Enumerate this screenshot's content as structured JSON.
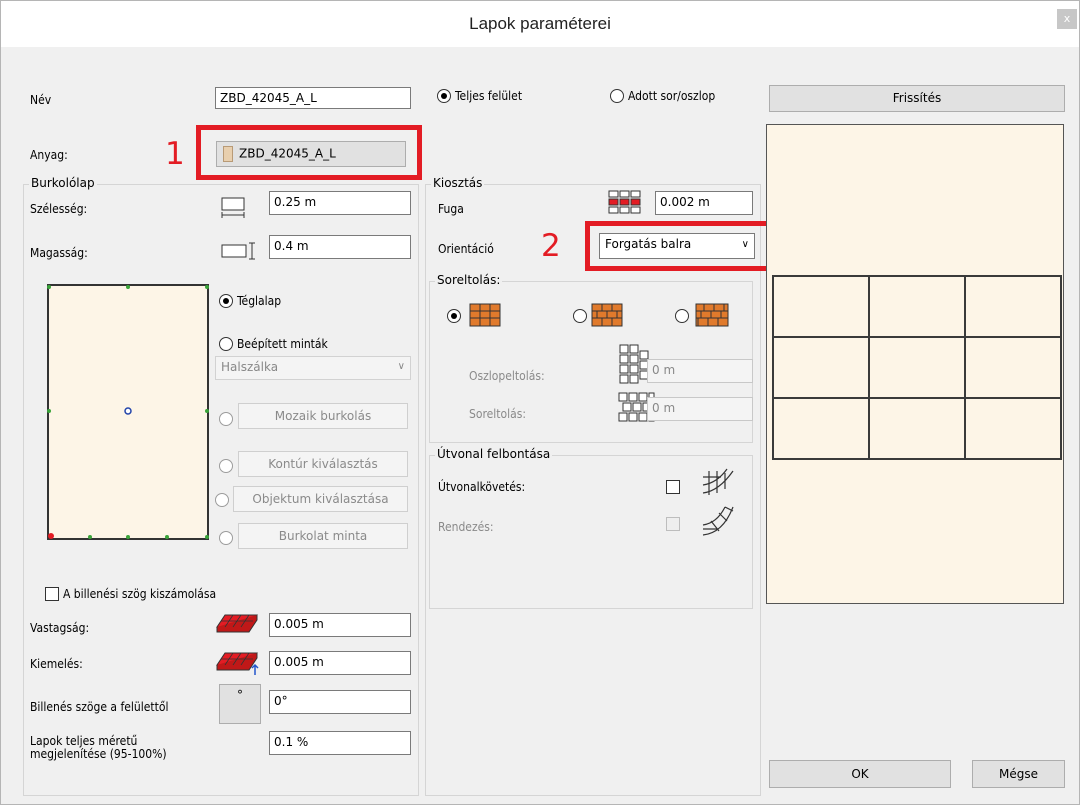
{
  "window": {
    "title": "Lapok paraméterei",
    "close_glyph": "x"
  },
  "name": {
    "label": "Név",
    "value": "ZBD_42045_A_L"
  },
  "material": {
    "label": "Anyag:",
    "button_label": "ZBD_42045_A_L",
    "swatch_color": "#e8cfae"
  },
  "annotations": {
    "num1": "1",
    "num2": "2",
    "color": "#e31c24"
  },
  "tile": {
    "group_title": "Burkolólap",
    "width_label": "Szélesség:",
    "width_value": "0.25 m",
    "height_label": "Magasság:",
    "height_value": "0.4 m"
  },
  "shape_options": {
    "rectangle": "Téglalap",
    "builtin_patterns": "Beépített minták",
    "pattern_select": "Halszálka",
    "mosaic": "Mozaik burkolás",
    "contour": "Kontúr kiválasztás",
    "object": "Objektum kiválasztása",
    "cover_pattern": "Burkolat minta"
  },
  "tilt_checkbox": "A billenési szög kiszámolása",
  "thickness": {
    "label": "Vastagság:",
    "value": "0.005 m"
  },
  "elevation": {
    "label": "Kiemelés:",
    "value": "0.005 m"
  },
  "tilt_angle": {
    "label": "Billenés szöge a felülettől",
    "button": "°",
    "value": "0°"
  },
  "fullsize": {
    "label_line1": "Lapok teljes méretű",
    "label_line2": "megjelenítése (95-100%)",
    "value": "0.1 %"
  },
  "surface": {
    "full": "Teljes felület",
    "given": "Adott sor/oszlop"
  },
  "layout": {
    "group_title": "Kiosztás",
    "joint_label": "Fuga",
    "joint_value": "0.002 m",
    "orientation_label": "Orientáció",
    "orientation_value": "Forgatás balra"
  },
  "row_offset": {
    "group_title": "Soreltolás:",
    "column_offset_label": "Oszlopeltolás:",
    "column_offset_value": "0 m",
    "row_offset_label": "Soreltolás:",
    "row_offset_value": "0 m"
  },
  "path": {
    "group_title": "Útvonal felbontása",
    "follow_label": "Útvonalkövetés:",
    "arrange_label": "Rendezés:"
  },
  "buttons": {
    "refresh": "Frissítés",
    "ok": "OK",
    "cancel": "Mégse"
  },
  "colors": {
    "preview_bg": "#fdf5e7",
    "brick": "#e07a2c"
  }
}
